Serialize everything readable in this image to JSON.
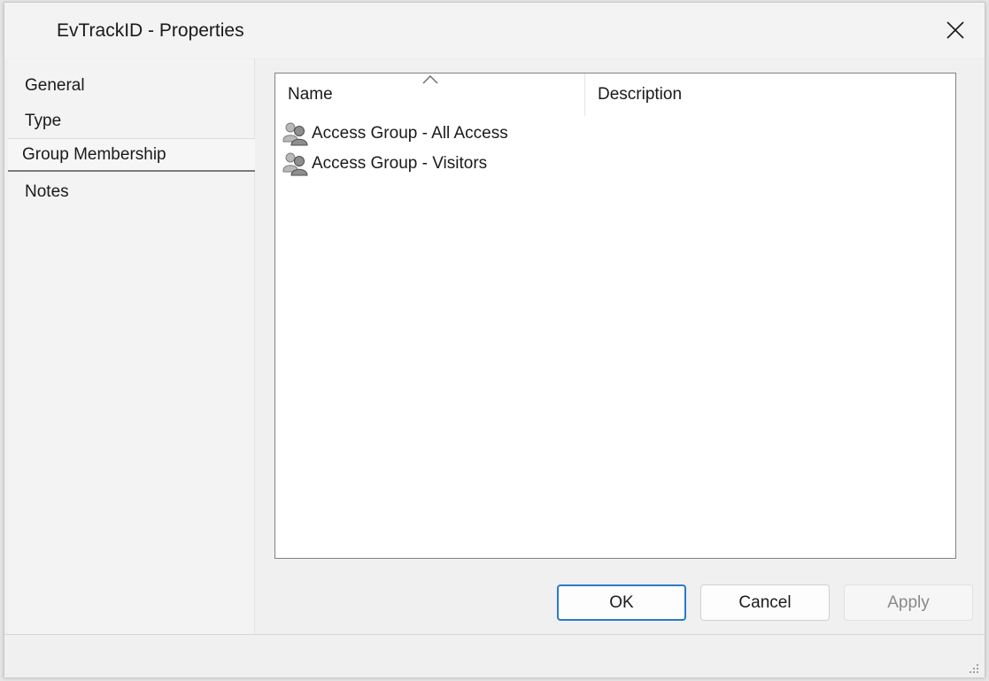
{
  "window": {
    "title": "EvTrackID - Properties"
  },
  "sidebar": {
    "items": [
      {
        "label": "General",
        "selected": false
      },
      {
        "label": "Type",
        "selected": false
      },
      {
        "label": "Group Membership",
        "selected": true
      },
      {
        "label": "Notes",
        "selected": false
      }
    ]
  },
  "list": {
    "columns": {
      "name": "Name",
      "description": "Description"
    },
    "sort": "name-ascending",
    "rows": [
      {
        "name": "Access Group - All Access",
        "description": "",
        "icon": "group-icon"
      },
      {
        "name": "Access Group - Visitors",
        "description": "",
        "icon": "group-icon"
      }
    ]
  },
  "buttons": {
    "ok": "OK",
    "cancel": "Cancel",
    "apply": "Apply",
    "apply_enabled": false
  },
  "colors": {
    "default_button_border": "#2b79c7",
    "window_bg": "#f0f0f0"
  }
}
